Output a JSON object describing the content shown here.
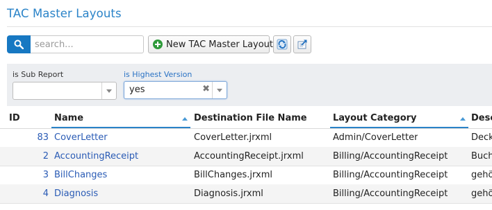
{
  "page": {
    "title": "TAC Master Layouts"
  },
  "toolbar": {
    "search_placeholder": "search...",
    "new_button_label": "New TAC Master Layout"
  },
  "filters": {
    "sub_report": {
      "label": "is Sub Report",
      "value": ""
    },
    "highest_version": {
      "label": "is Highest Version",
      "value": "yes"
    }
  },
  "grid": {
    "columns": [
      "ID",
      "Name",
      "Destination File Name",
      "Layout Category",
      "Desc"
    ],
    "rows": [
      {
        "id": "83",
        "name": "CoverLetter",
        "file": "CoverLetter.jrxml",
        "category": "Admin/CoverLetter",
        "desc": "Deck"
      },
      {
        "id": "2",
        "name": "AccountingReceipt",
        "file": "AccountingReceipt.jrxml",
        "category": "Billing/AccountingReceipt",
        "desc": "Buch"
      },
      {
        "id": "3",
        "name": "BillChanges",
        "file": "BillChanges.jrxml",
        "category": "Billing/AccountingReceipt",
        "desc": "gehö"
      },
      {
        "id": "4",
        "name": "Diagnosis",
        "file": "Diagnosis.jrxml",
        "category": "Billing/AccountingReceipt",
        "desc": "gehö"
      }
    ]
  },
  "colors": {
    "accent": "#2a83c8",
    "search_button": "#1778c2",
    "link": "#2a5bb5",
    "add": "#2e9a3a"
  },
  "icons": [
    "search-icon",
    "plus-icon",
    "refresh-icon",
    "export-icon",
    "clear-icon",
    "chevron-down-icon",
    "sort-asc-icon"
  ]
}
